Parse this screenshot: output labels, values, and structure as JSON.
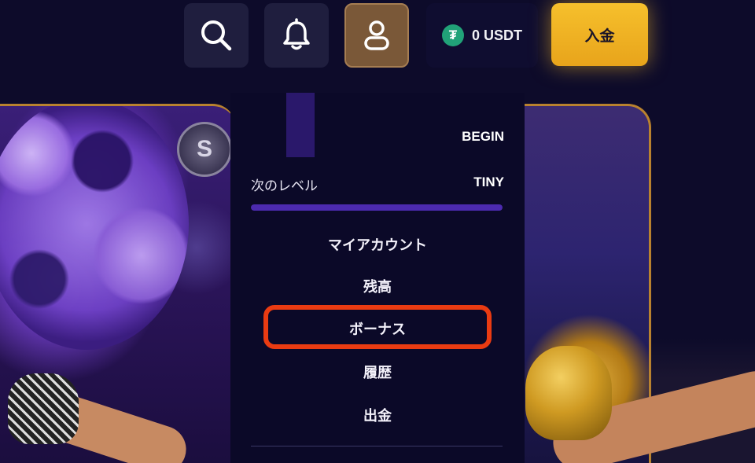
{
  "header": {
    "icons": [
      "search-icon",
      "bell-icon",
      "user-icon"
    ],
    "wallet": {
      "currency_symbol": "₮",
      "balance_text": "0 USDT"
    },
    "deposit_label": "入金"
  },
  "colors": {
    "background": "#0d0b2a",
    "accent_gold": "#f6c02c",
    "highlight_red": "#ea3b12",
    "progress_purple": "#4c2ab0"
  },
  "dropdown": {
    "current_level": "BEGIN",
    "next_level_label": "次のレベル",
    "next_level_value": "TINY",
    "level_progress_fraction": 1.0,
    "menu": [
      {
        "label": "マイアカウント"
      },
      {
        "label": "残高"
      },
      {
        "label": "ボーナス",
        "highlighted": true
      },
      {
        "label": "履歴"
      },
      {
        "label": "出金"
      }
    ]
  },
  "banner": {
    "coin_symbol": "S"
  }
}
